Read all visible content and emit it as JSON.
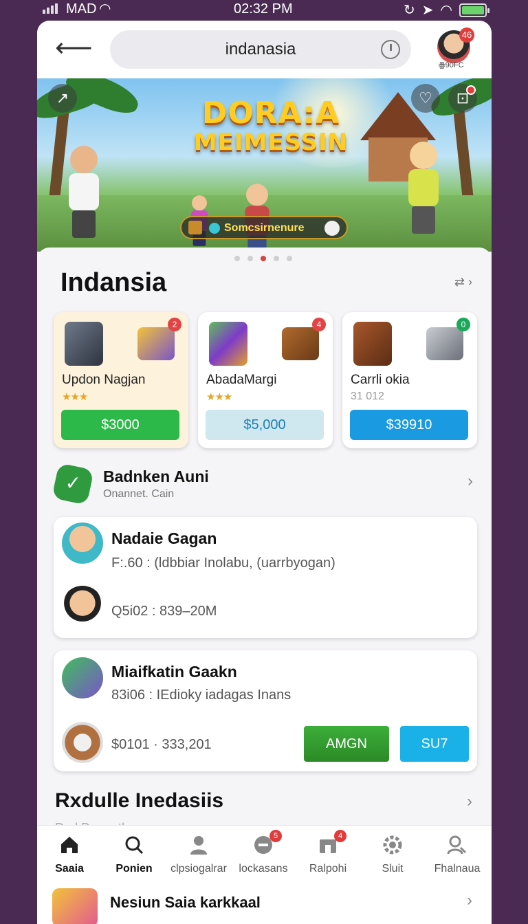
{
  "status_bar": {
    "carrier": "MAD",
    "time": "02:32 PM"
  },
  "header": {
    "search_query": "indanasia",
    "avatar_badge": "46",
    "avatar_caption": "ꙮ90FC"
  },
  "banner": {
    "title_line1": "DORA:A",
    "title_line2": "MEIMESSIN",
    "pill_text": "Somcsirnenure",
    "active_slide": 3,
    "slide_count": 5
  },
  "section": {
    "title": "Indansia",
    "cards": [
      {
        "name": "Updon Nagjan",
        "rating": 3,
        "price": "$3000",
        "badge": "2",
        "price_color": "#2db84a",
        "badge_color": "#e24444"
      },
      {
        "name": "AbadaMargi",
        "rating": 3,
        "price": "$5,000",
        "badge": "4",
        "price_color": "#cfe7ef",
        "badge_color": "#e24444"
      },
      {
        "name": "Carrli okia",
        "sub": "31 012",
        "price": "$39910",
        "badge": "0",
        "price_color": "#1a9ae0",
        "badge_color": "#1aa85a"
      }
    ]
  },
  "verified_row": {
    "title": "Badnken Auni",
    "subtitle": "Onannet. Cain"
  },
  "list_card_1": {
    "title": "Nadaie Gagan",
    "line1": "F:.60 : (ldbbiar Inolabu, (uarrbyogan)",
    "line2": "Q5i02 : 839–20M"
  },
  "list_card_2": {
    "title": "Miaifkatin Gaakn",
    "line1": "83i06 : IEdioky iadagas Inans",
    "line2": "$0101 · 333,201",
    "btn_primary": "AMGN",
    "btn_secondary": "SU7"
  },
  "section2": {
    "title": "Rxdulle Inedasiis",
    "peek_text": "Dral Drumath"
  },
  "tabs": [
    {
      "label": "Saaia",
      "active": true
    },
    {
      "label": "Ponien",
      "active": false
    },
    {
      "label": "clpsiogalrar",
      "active": false
    },
    {
      "label": "lockasans",
      "active": false,
      "badge": "5"
    },
    {
      "label": "Ralpohi",
      "active": false,
      "badge": "4"
    },
    {
      "label": "Sluit",
      "active": false
    },
    {
      "label": "Fhalnaua",
      "active": false
    }
  ],
  "peek_row": {
    "title": "Nesiun Saia karkkaal"
  },
  "colors": {
    "brand_purple": "#4a2a52",
    "accent_red": "#d64545",
    "green": "#2db84a",
    "blue": "#1a9ae0"
  }
}
